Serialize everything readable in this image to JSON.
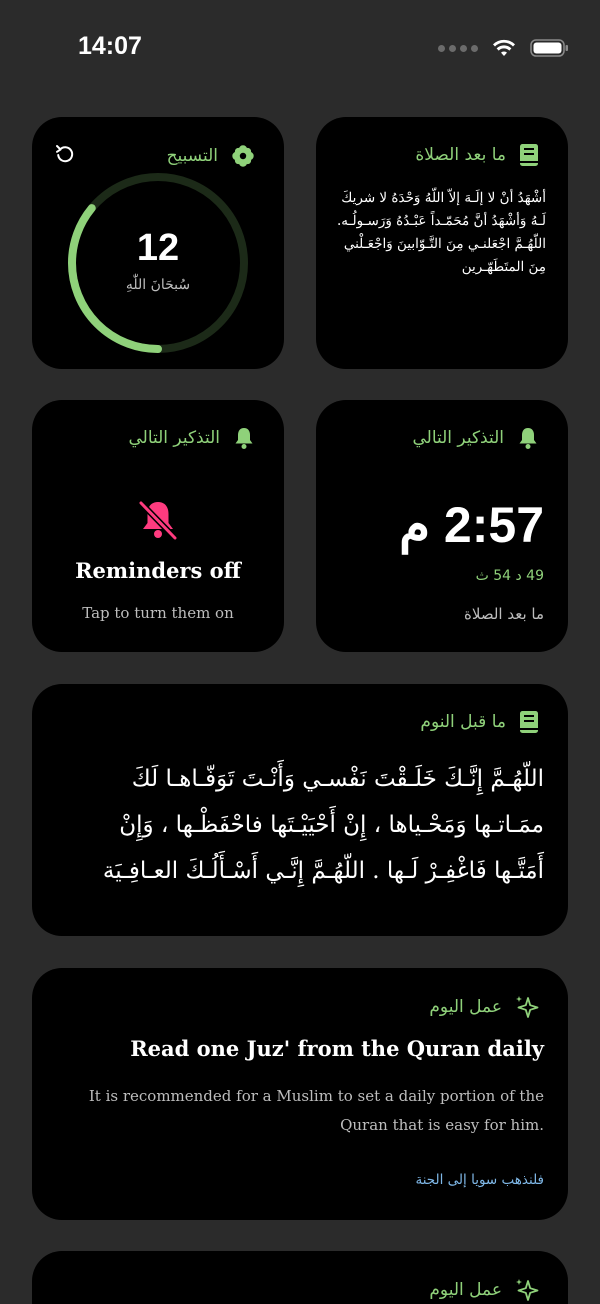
{
  "status": {
    "time": "14:07"
  },
  "tasbih": {
    "title": "التسبيح",
    "count": "12",
    "dhikr": "سُبحَانَ اللّٰهِ",
    "progress": 0.36
  },
  "after_prayer": {
    "title": "ما بعد الصلاة",
    "text": "أشْهَدُ أنْ لا إلَـهَ إلاّ اللّهُ وَحْدَهُ لا شريكَ لَـهُ وَأشْهَدُ أنَّ مُحَمّـداً عَبْـدُهُ وَرَسـولُـه. اللّهُـمَّ اجْعَلنـي مِنَ التَّـوّابينَ وَاجْعَـلْني مِنَ المتَطَهّـرين"
  },
  "reminder_off": {
    "title": "التذكير التالي",
    "status": "Reminders off",
    "hint": "Tap to turn them on"
  },
  "next_reminder": {
    "title": "التذكير التالي",
    "time": "2:57 م",
    "remaining": "49 د 54 ث",
    "label": "ما بعد الصلاة"
  },
  "before_sleep": {
    "title": "ما قبل النوم",
    "text": "اللّهُـمَّ إِنَّـكَ خَلَـقْتَ نَفْسـي وَأَنْـتَ تَوَفّـاهـا لَكَ ممَـاتـها وَمَحْـياها ، إِنْ أَحْيَيْـتَها فاحْفَظْـها ، وَإِنْ أَمَتَّـها فَاغْفِـرْ لَـها . اللّهُـمَّ إِنَّـي أَسْـأَلُـكَ العـافِـيَة"
  },
  "deed_1": {
    "title": "عمل اليوم",
    "heading": "Read one Juz' from the Quran daily",
    "description": "It is recommended for a Muslim to set a daily portion of the Quran that is easy for him.",
    "link": "فلنذهب سويا إلى الجنة"
  },
  "deed_2": {
    "title": "عمل اليوم"
  },
  "colors": {
    "accent": "#8fd17a",
    "background": "#2b2b2b",
    "card": "#000000",
    "alert": "#ff3b7f",
    "link": "#7fb8e8"
  }
}
